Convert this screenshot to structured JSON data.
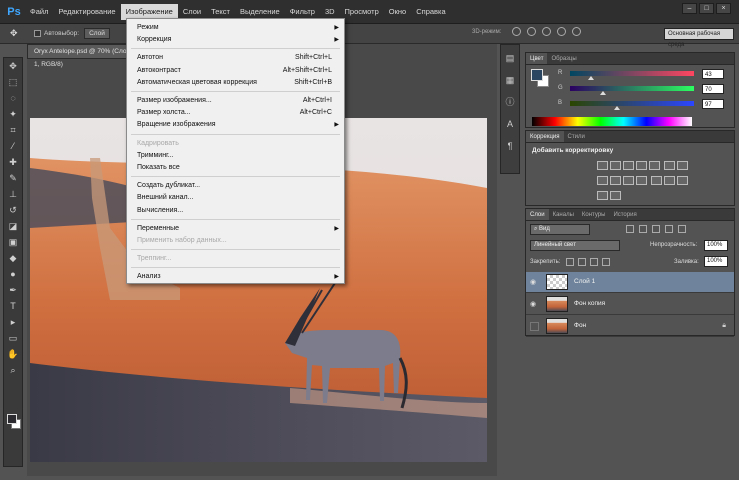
{
  "app": {
    "logo": "Ps"
  },
  "menubar": {
    "items": [
      "Файл",
      "Редактирование",
      "Изображение",
      "Слои",
      "Текст",
      "Выделение",
      "Фильтр",
      "3D",
      "Просмотр",
      "Окно",
      "Справка"
    ],
    "active_index": 2
  },
  "window_controls": {
    "minimize": "–",
    "maximize": "□",
    "close": "×"
  },
  "options_bar": {
    "autoselect_label": "Автовыбор:",
    "autoselect_value": "Слой",
    "mode_3d_label": "3D-режим:",
    "workspace": "Основная рабочая среда"
  },
  "document": {
    "tab_title": "Oryx Antelope.psd @ 70% (Слой 1, RGB/8)"
  },
  "image_menu": {
    "items": [
      {
        "label": "Режим",
        "shortcut": "",
        "submenu": true,
        "disabled": false
      },
      {
        "label": "Коррекция",
        "shortcut": "",
        "submenu": true,
        "disabled": false
      },
      {
        "label": "Автотон",
        "shortcut": "Shift+Ctrl+L",
        "submenu": false,
        "disabled": false
      },
      {
        "label": "Автоконтраст",
        "shortcut": "Alt+Shift+Ctrl+L",
        "submenu": false,
        "disabled": false
      },
      {
        "label": "Автоматическая цветовая коррекция",
        "shortcut": "Shift+Ctrl+B",
        "submenu": false,
        "disabled": false
      },
      {
        "label": "Размер изображения...",
        "shortcut": "Alt+Ctrl+I",
        "submenu": false,
        "disabled": false
      },
      {
        "label": "Размер холста...",
        "shortcut": "Alt+Ctrl+C",
        "submenu": false,
        "disabled": false
      },
      {
        "label": "Вращение изображения",
        "shortcut": "",
        "submenu": true,
        "disabled": false
      },
      {
        "label": "Кадрировать",
        "shortcut": "",
        "submenu": false,
        "disabled": true
      },
      {
        "label": "Тримминг...",
        "shortcut": "",
        "submenu": false,
        "disabled": false
      },
      {
        "label": "Показать все",
        "shortcut": "",
        "submenu": false,
        "disabled": false
      },
      {
        "label": "Создать дубликат...",
        "shortcut": "",
        "submenu": false,
        "disabled": false
      },
      {
        "label": "Внешний канал...",
        "shortcut": "",
        "submenu": false,
        "disabled": false
      },
      {
        "label": "Вычисления...",
        "shortcut": "",
        "submenu": false,
        "disabled": false
      },
      {
        "label": "Переменные",
        "shortcut": "",
        "submenu": true,
        "disabled": false
      },
      {
        "label": "Применить набор данных...",
        "shortcut": "",
        "submenu": false,
        "disabled": true
      },
      {
        "label": "Треппинг...",
        "shortcut": "",
        "submenu": false,
        "disabled": true
      },
      {
        "label": "Анализ",
        "shortcut": "",
        "submenu": true,
        "disabled": false
      }
    ]
  },
  "color_panel": {
    "tabs": [
      "Цвет",
      "Образцы"
    ],
    "channels": [
      {
        "label": "R",
        "value": "43",
        "fraction": 0.17
      },
      {
        "label": "G",
        "value": "70",
        "fraction": 0.27
      },
      {
        "label": "B",
        "value": "97",
        "fraction": 0.38
      }
    ],
    "foreground": "#2b4661"
  },
  "adjustments_panel": {
    "tabs": [
      "Коррекция",
      "Стили"
    ],
    "title": "Добавить корректировку"
  },
  "layers_panel": {
    "tabs": [
      "Слои",
      "Каналы",
      "Контуры",
      "История"
    ],
    "filter": "Вид",
    "blend_mode": "Линейный свет",
    "opacity_label": "Непрозрачность:",
    "opacity_value": "100%",
    "lock_label": "Закрепить:",
    "fill_label": "Заливка:",
    "fill_value": "100%",
    "layers": [
      {
        "name": "Слой 1",
        "selected": true,
        "visible": true,
        "locked": false,
        "thumb": "transparent"
      },
      {
        "name": "Фон копия",
        "selected": false,
        "visible": true,
        "locked": false,
        "thumb": "desert"
      },
      {
        "name": "Фон",
        "selected": false,
        "visible": false,
        "locked": true,
        "thumb": "desert"
      }
    ]
  },
  "colors": {
    "menu_active": "#d9d9d9",
    "selected_layer": "#6f849c",
    "ps_blue": "#3fa7ff"
  }
}
